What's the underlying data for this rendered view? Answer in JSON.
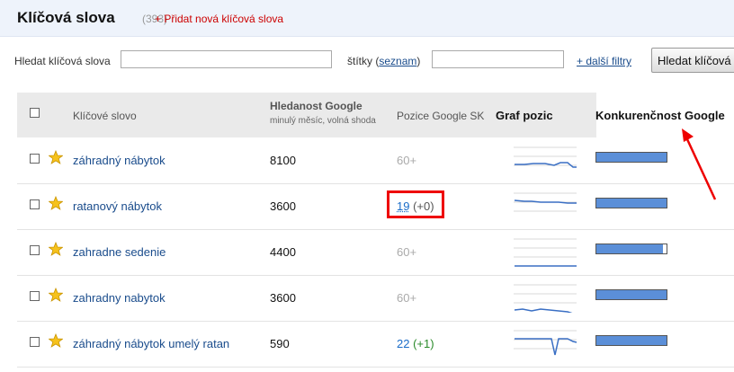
{
  "header": {
    "title": "Klíčová slova",
    "count": "(393)",
    "add_link": "+ Přidat nová klíčová slova"
  },
  "filters": {
    "keyword_label": "Hledat klíčová slova",
    "keyword_value": "",
    "tags_label": "štítky",
    "tags_link": "seznam",
    "tags_value": "",
    "more_filters": "+ další filtry",
    "search_button": "Hledat klíčová"
  },
  "table": {
    "col_keyword": "Klíčové slovo",
    "col_volume": "Hledanost Google",
    "col_volume_sub": "minulý měsíc, volná shoda",
    "col_position": "Pozice Google SK",
    "col_graph": "Graf pozic",
    "col_competition": "Konkurenčnost Google",
    "rows": [
      {
        "keyword": "záhradný nábytok",
        "volume": "8100",
        "position": "60+",
        "change": "",
        "competition": 1.0
      },
      {
        "keyword": "ratanový nábytok",
        "volume": "3600",
        "position": "19",
        "change": "(+0)",
        "competition": 1.0
      },
      {
        "keyword": "zahradne sedenie",
        "volume": "4400",
        "position": "60+",
        "change": "",
        "competition": 0.95
      },
      {
        "keyword": "zahradny nabytok",
        "volume": "3600",
        "position": "60+",
        "change": "",
        "competition": 1.0
      },
      {
        "keyword": "záhradný nábytok umelý ratan",
        "volume": "590",
        "position": "22",
        "change": "(+1)",
        "competition": 1.0
      }
    ]
  },
  "colors": {
    "accent_red": "#ee0000",
    "link_blue": "#1a4c8c",
    "bar_fill": "#5b8fd8"
  }
}
